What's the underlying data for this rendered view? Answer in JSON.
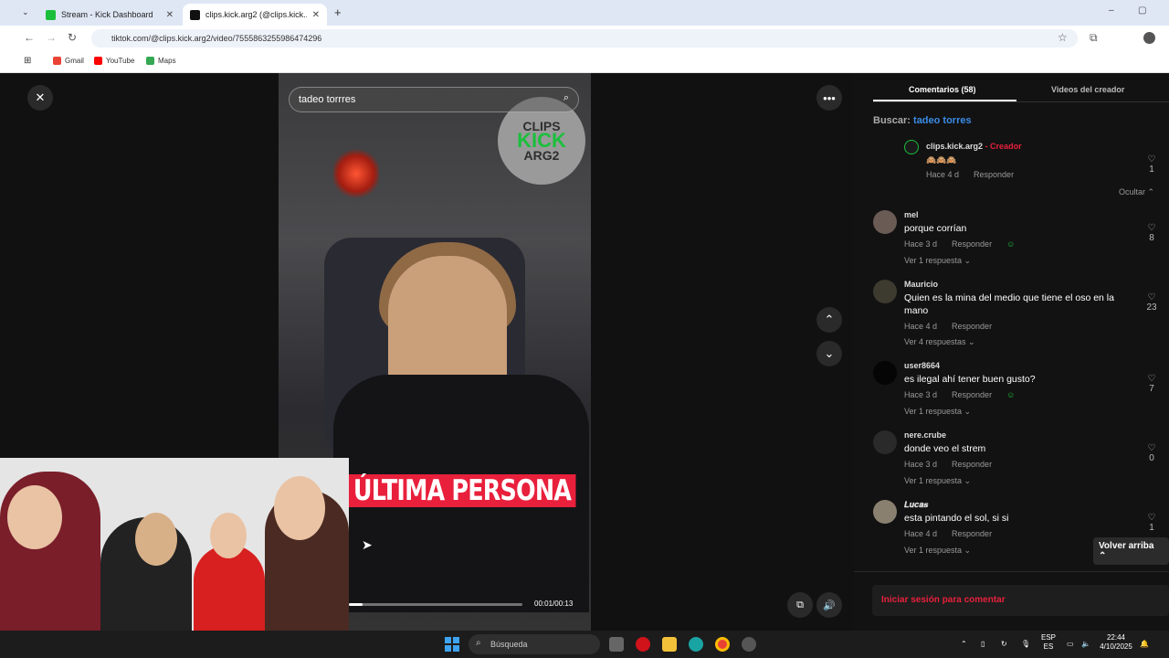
{
  "browser": {
    "tabs": [
      {
        "title": "Stream - Kick Dashboard",
        "active": false
      },
      {
        "title": "clips.kick.arg2 (@clips.kick...",
        "active": true
      }
    ],
    "url": "tiktok.com/@clips.kick.arg2/video/7555863255986474296",
    "bookmarks": [
      "Gmail",
      "YouTube",
      "Maps"
    ]
  },
  "player": {
    "search_query": "tadeo torrres",
    "logo_lines": [
      "CLIPS",
      "KICK",
      "ARG2"
    ],
    "caption": "ÚLTIMA PERSONA",
    "time": "00:01/00:13",
    "progress": 0.08
  },
  "panel": {
    "tab_comments": "Comentarios (58)",
    "tab_videos": "Videos del creador",
    "search_label": "Buscar:",
    "search_term": "tadeo torres",
    "hide_label": "Ocultar",
    "comments": [
      {
        "name": "clips.kick.arg2",
        "creator_tag": "- Creador",
        "text": "🙈🙈🙈",
        "time": "Hace 4 d",
        "reply": "Responder",
        "likes": "1",
        "replies": ""
      },
      {
        "name": "mel",
        "text": "porque corrían",
        "time": "Hace 3 d",
        "reply": "Responder",
        "likes": "8",
        "replies": "Ver 1 respuesta ⌄"
      },
      {
        "name": "Mauricio",
        "text": "Quien es la mina del medio que tiene el oso en la mano",
        "time": "Hace 4 d",
        "reply": "Responder",
        "likes": "23",
        "replies": "Ver 4 respuestas ⌄"
      },
      {
        "name": "user8664",
        "text": "es ilegal ahí tener buen gusto?",
        "time": "Hace 3 d",
        "reply": "Responder",
        "likes": "7",
        "replies": "Ver 1 respuesta ⌄"
      },
      {
        "name": "nere.crube",
        "text": "donde veo el strem",
        "time": "Hace 3 d",
        "reply": "Responder",
        "likes": "0",
        "replies": "Ver 1 respuesta ⌄"
      },
      {
        "name": "𝑳𝒖𝒄𝒂𝒔",
        "text": "esta pintando el sol, si si",
        "time": "Hace 4 d",
        "reply": "Responder",
        "likes": "1",
        "replies": "Ver 1 respuesta ⌄"
      }
    ],
    "back_to_top": "Volver arriba",
    "login_prompt": "Iniciar sesión para comentar"
  },
  "taskbar": {
    "search_placeholder": "Búsqueda",
    "lang_top": "ESP",
    "lang_bottom": "ES",
    "time": "22:44",
    "date": "4/10/2025"
  },
  "colors": {
    "tiktok_red": "#e8203c",
    "kick_green": "#1bbf3c",
    "link_blue": "#3b8ce6"
  }
}
